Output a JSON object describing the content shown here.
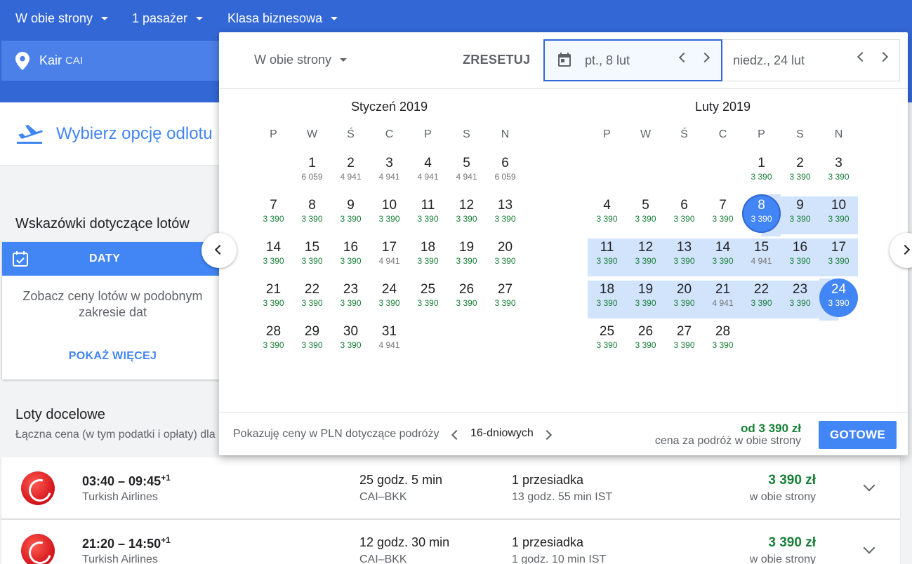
{
  "search": {
    "trip_type": "W obie strony",
    "passengers": "1 pasażer",
    "cabin": "Klasa biznesowa",
    "origin_city": "Kair",
    "origin_code": "CAI"
  },
  "departure_header": "Wybierz opcję odlotu",
  "tips": {
    "title": "Wskazówki dotyczące lotów",
    "card_label": "DATY",
    "card_text": "Zobacz ceny lotów w podobnym zakresie dat",
    "card_link": "POKAŻ WIĘCEJ"
  },
  "destinations": {
    "title": "Loty docelowe",
    "subtitle": "Łączna cena (w tym podatki i opłaty) dla"
  },
  "flights": [
    {
      "times": "03:40 – 09:45",
      "plus": "+1",
      "airline": "Turkish Airlines",
      "duration": "25 godz. 5 min",
      "route": "CAI–BKK",
      "stops": "1 przesiadka",
      "layover": "13 godz. 55 min IST",
      "price": "3 390 zł",
      "price_type": "w obie strony"
    },
    {
      "times": "21:20 – 14:50",
      "plus": "+1",
      "airline": "Turkish Airlines",
      "duration": "12 godz. 30 min",
      "route": "CAI–BKK",
      "stops": "1 przesiadka",
      "layover": "1 godz. 10 min IST",
      "price": "3 390 zł",
      "price_type": "w obie strony"
    }
  ],
  "picker": {
    "trip_type": "W obie strony",
    "reset": "ZRESETUJ",
    "departure_date": "pt., 8 lut",
    "return_date": "niedz., 24 lut",
    "weekdays": [
      "P",
      "W",
      "Ś",
      "C",
      "P",
      "S",
      "N"
    ],
    "months": [
      {
        "title": "Styczeń 2019",
        "offset": 1,
        "days": [
          {
            "d": "1",
            "p": "6 059",
            "g": true
          },
          {
            "d": "2",
            "p": "4 941",
            "g": true
          },
          {
            "d": "3",
            "p": "4 941",
            "g": true
          },
          {
            "d": "4",
            "p": "4 941",
            "g": true
          },
          {
            "d": "5",
            "p": "4 941",
            "g": true
          },
          {
            "d": "6",
            "p": "6 059",
            "g": true
          },
          {
            "d": "7",
            "p": "3 390"
          },
          {
            "d": "8",
            "p": "3 390"
          },
          {
            "d": "9",
            "p": "3 390"
          },
          {
            "d": "10",
            "p": "3 390"
          },
          {
            "d": "11",
            "p": "3 390"
          },
          {
            "d": "12",
            "p": "3 390"
          },
          {
            "d": "13",
            "p": "3 390"
          },
          {
            "d": "14",
            "p": "3 390"
          },
          {
            "d": "15",
            "p": "3 390"
          },
          {
            "d": "16",
            "p": "3 390"
          },
          {
            "d": "17",
            "p": "4 941",
            "g": true
          },
          {
            "d": "18",
            "p": "3 390"
          },
          {
            "d": "19",
            "p": "3 390"
          },
          {
            "d": "20",
            "p": "3 390"
          },
          {
            "d": "21",
            "p": "3 390"
          },
          {
            "d": "22",
            "p": "3 390"
          },
          {
            "d": "23",
            "p": "3 390"
          },
          {
            "d": "24",
            "p": "3 390"
          },
          {
            "d": "25",
            "p": "3 390"
          },
          {
            "d": "26",
            "p": "3 390"
          },
          {
            "d": "27",
            "p": "3 390"
          },
          {
            "d": "28",
            "p": "3 390"
          },
          {
            "d": "29",
            "p": "3 390"
          },
          {
            "d": "30",
            "p": "3 390"
          },
          {
            "d": "31",
            "p": "4 941",
            "g": true
          }
        ]
      },
      {
        "title": "Luty 2019",
        "offset": 4,
        "days": [
          {
            "d": "1",
            "p": "3 390"
          },
          {
            "d": "2",
            "p": "3 390"
          },
          {
            "d": "3",
            "p": "3 390"
          },
          {
            "d": "4",
            "p": "3 390"
          },
          {
            "d": "5",
            "p": "3 390"
          },
          {
            "d": "6",
            "p": "3 390"
          },
          {
            "d": "7",
            "p": "3 390"
          },
          {
            "d": "8",
            "p": "3 390",
            "s": "start"
          },
          {
            "d": "9",
            "p": "3 390",
            "r": true
          },
          {
            "d": "10",
            "p": "3 390",
            "r": true
          },
          {
            "d": "11",
            "p": "3 390",
            "r": true
          },
          {
            "d": "12",
            "p": "3 390",
            "r": true
          },
          {
            "d": "13",
            "p": "3 390",
            "r": true
          },
          {
            "d": "14",
            "p": "3 390",
            "r": true
          },
          {
            "d": "15",
            "p": "4 941",
            "g": true,
            "r": true
          },
          {
            "d": "16",
            "p": "3 390",
            "r": true
          },
          {
            "d": "17",
            "p": "3 390",
            "r": true
          },
          {
            "d": "18",
            "p": "3 390",
            "r": true
          },
          {
            "d": "19",
            "p": "3 390",
            "r": true
          },
          {
            "d": "20",
            "p": "3 390",
            "r": true
          },
          {
            "d": "21",
            "p": "4 941",
            "g": true,
            "r": true
          },
          {
            "d": "22",
            "p": "3 390",
            "r": true
          },
          {
            "d": "23",
            "p": "3 390",
            "r": true
          },
          {
            "d": "24",
            "p": "3 390",
            "s": "end"
          },
          {
            "d": "25",
            "p": "3 390"
          },
          {
            "d": "26",
            "p": "3 390"
          },
          {
            "d": "27",
            "p": "3 390"
          },
          {
            "d": "28",
            "p": "3 390"
          }
        ]
      }
    ],
    "footer_info": "Pokazuję ceny w PLN dotyczące podróży",
    "trip_length": "16-dniowych",
    "from_price": "od 3 390 zł",
    "from_price_sub": "cena za podróż w obie strony",
    "done": "GOTOWE"
  },
  "colors": {
    "brand_blue": "#3367d6",
    "accent": "#4285f4",
    "price_green": "#188038",
    "range": "#d2e3fc"
  }
}
